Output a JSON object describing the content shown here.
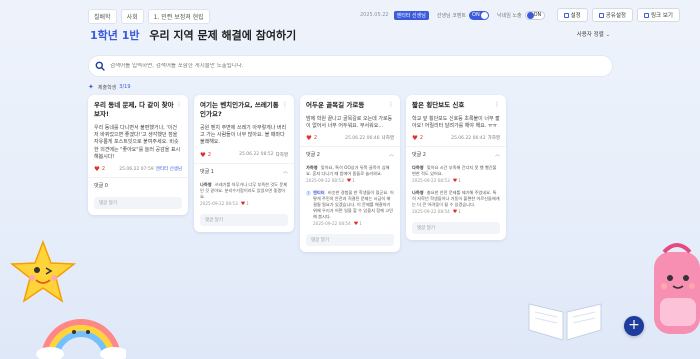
{
  "topbar": {
    "crumbs": [
      "칠배학",
      "사회",
      "1. 민쯴 보정져 현립"
    ],
    "date": "2025.05.22",
    "teacher_badge": "엔티터 선생님",
    "toggle1_label": "선생님 코멘트",
    "toggle1_state": "ON",
    "toggle2_label": "낙네임 노출",
    "toggle2_state": "ON",
    "settings_label": "설정",
    "share_label": "공유설정",
    "link_label": "링크 보기"
  },
  "header": {
    "class_name": "1학년 1반",
    "board_title": "우리 지역 문제 해결에 참여하기",
    "sort_label": "사용자 정렬"
  },
  "search": {
    "placeholder": "검색어를 입력하면, 검색어를 포함한 게시물만 노출됩니다."
  },
  "participants": {
    "label": "제출학생",
    "count": "3/19"
  },
  "cards": [
    {
      "title": "우리 동네 문제, 다 같이 찾아보자!",
      "body": "우리 동네를 다니면서 불편했거나, '이건 저 바뀌었으면 좋겠다!'고 생각했던 점을 자유롭게 포스트잇으로 붙여주세요. 비슷한 의견에는 \"좋아요\"를 눌러 공감을 표시해봅시다!",
      "likes": "2",
      "date": "25.06.22 07:59",
      "author": "엔티터 선생님",
      "comments_label": "댓글 0",
      "comment_placeholder": "댓글 달기"
    },
    {
      "title": "여기는 벤치인가요, 쓰레기통인가요?",
      "body": "공원 벤치 주변에 쓰레기 아무렇게나 버리고 가는 사람들이 너무 많아요. 볼 때마다 불쾌해요.",
      "likes": "2",
      "date": "25.06.22 08:52",
      "author": "다하영",
      "comments_label": "댓글 1",
      "comment_name": "나하영",
      "comment_text": "쓰레기를 아무거나 너무 부족한 것도 문제인 것 같아요. 분리수거함이라도 있었으면 좋겠어요.",
      "comment_date": "2025-09-22 08:53",
      "comment_likes": "1",
      "comment_placeholder": "댓글 달기"
    },
    {
      "title": "어두운 골목길 가로등",
      "body": "밤에 학원 끝나고 골목길로 오는데 가로등이 없어서 너무 어두워요. 무서워요...",
      "likes": "2",
      "date": "25.06.22 06:46",
      "author": "나하영",
      "comments_label": "댓글 2",
      "comment1_name": "가하영",
      "comment1_text": "맞아요, 특히 OO상가 뒤쪽 골목이 심해요. 혼자 다니기 때 밤에어 좀들로 놀러와요.",
      "comment1_date": "2025-09-22 08:53",
      "comment1_likes": "1",
      "comment2_name": "엔티터",
      "comment2_text": "비슷한 경험을 한 학생들이 많군요. 어떻게 주민의 안전과 직결된 문제는 시급히 해결될 필요가 있겠습니다. 이 문제를 해결하기 위해 우리가 어떤 일을 할 수 있을지 함께 고민해 봅시다.",
      "comment2_date": "2025-09-22 08:54",
      "comment2_likes": "1",
      "comment_placeholder": "댓글 달기"
    },
    {
      "title": "짧은 횡단보도 신호",
      "body": "학교 앞 횡단보도 신호등 초록불이 너무 짧아요! 어릴리터 달려가를 해야 해요. ㅠㅠ",
      "likes": "2",
      "date": "25.06.22 06:42",
      "author": "가하영",
      "comments_label": "댓글 2",
      "comment1_name": "다하영",
      "comment1_text": "맞아요 시간 부족해 건너지 못 했 빨간불 변한 적도 있어요.",
      "comment1_date": "2025-09-22 08:53",
      "comment1_likes": "1",
      "comment2_name": "나하영",
      "comment2_text": "충요한 안전 문제를 제기해 주었네요. 특히 저학년 학생들이나 거동이 불편한 어르신들에게는 더 큰 어려움이 될 수 있겠습니다.",
      "comment2_date": "2025-09-22 08:54",
      "comment2_likes": "1",
      "comment_placeholder": "댓글 달기"
    }
  ],
  "fab_label": "+",
  "colors": {
    "accent": "#3b5bdb",
    "like": "#e03131",
    "fab": "#1d3c9c"
  }
}
